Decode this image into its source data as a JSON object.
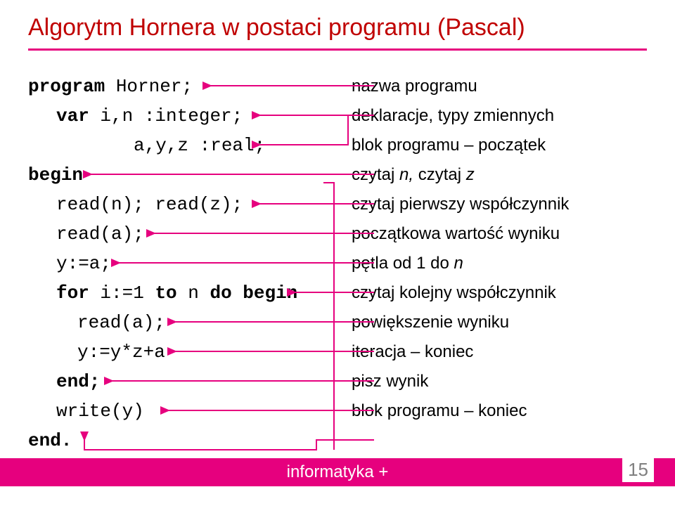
{
  "title": "Algorytm Hornera w postaci programu (Pascal)",
  "code": {
    "l1_a": "program",
    "l1_b": " Horner;",
    "l2_a": "var",
    "l2_b": " i,n  :integer;",
    "l3": "a,y,z :real;",
    "l4": "begin",
    "l5": "read(n); read(z);",
    "l6": "read(a);",
    "l7": "y:=a;",
    "l8_a": "for",
    "l8_b": " i:=1 ",
    "l8_c": "to",
    "l8_d": " n ",
    "l8_e": "do begin",
    "l9": "read(a);",
    "l10": "y:=y*z+a",
    "l11": "end;",
    "l12": "write(y)",
    "l13": "end."
  },
  "desc": {
    "l1": "nazwa programu",
    "l2": "deklaracje, typy zmiennych",
    "l3": "",
    "l4": "blok programu – początek",
    "l5_a": "czytaj ",
    "l5_b": "n,",
    "l5_c": " czytaj ",
    "l5_d": "z",
    "l6": "czytaj pierwszy współczynnik",
    "l7": "początkowa wartość wyniku",
    "l8_a": "pętla od 1 do ",
    "l8_b": "n",
    "l9": "czytaj  kolejny współczynnik",
    "l10": "powiększenie wyniku",
    "l11": "iteracja – koniec",
    "l12": "pisz wynik",
    "l13": "blok programu – koniec"
  },
  "footer": "informatyka +",
  "page": "15",
  "colors": {
    "accent": "#e6007e",
    "title": "#c00000"
  }
}
